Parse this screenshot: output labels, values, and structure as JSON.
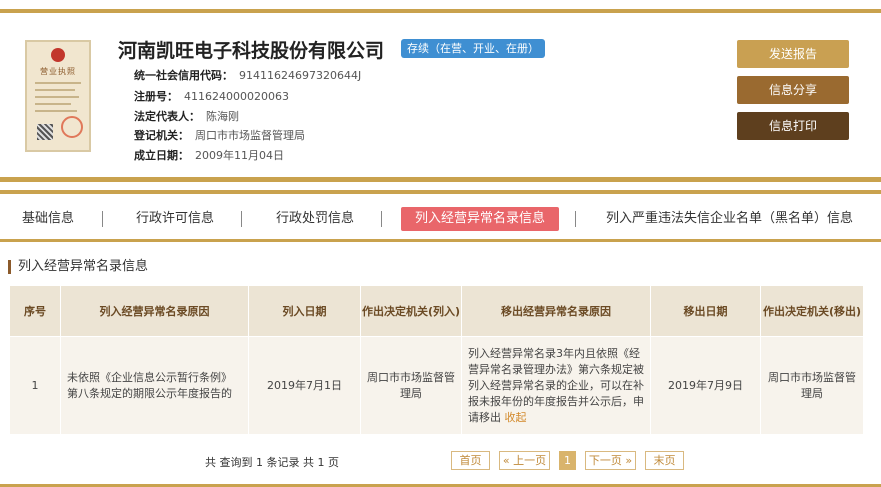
{
  "company": {
    "name": "河南凯旺电子科技股份有限公司",
    "status": "存续（在营、开业、在册）",
    "license_title": "营业执照"
  },
  "info": [
    {
      "label": "统一社会信用代码：",
      "value": "91411624697320644J"
    },
    {
      "label": "注册号：",
      "value": "411624000020063"
    },
    {
      "label": "法定代表人：",
      "value": "陈海刚"
    },
    {
      "label": "登记机关：",
      "value": "周口市市场监督管理局"
    },
    {
      "label": "成立日期：",
      "value": "2009年11月04日"
    }
  ],
  "actions": {
    "send": "发送报告",
    "share": "信息分享",
    "print": "信息打印"
  },
  "tabs": [
    {
      "label": "基础信息"
    },
    {
      "label": "行政许可信息"
    },
    {
      "label": "行政处罚信息"
    },
    {
      "label": "列入经营异常名录信息"
    },
    {
      "label": "列入严重违法失信企业名单（黑名单）信息"
    }
  ],
  "section": {
    "title": "列入经营异常名录信息"
  },
  "table": {
    "headers": [
      "序号",
      "列入经营异常名录原因",
      "列入日期",
      "作出决定机关(列入)",
      "移出经营异常名录原因",
      "移出日期",
      "作出决定机关(移出)"
    ],
    "rows": [
      {
        "index": "1",
        "reason": "未依照《企业信息公示暂行条例》第八条规定的期限公示年度报告的",
        "date_in": "2019年7月1日",
        "authority_in": "周口市市场监督管理局",
        "remove_reason": "列入经营异常名录3年内且依照《经营异常名录管理办法》第六条规定被列入经营异常名录的企业，可以在补报未报年份的年度报告并公示后，申请移出",
        "collapse": "收起",
        "date_out": "2019年7月9日",
        "authority_out": "周口市市场监督管理局"
      }
    ]
  },
  "pager": {
    "summary": "共 查询到 1 条记录 共 1 页",
    "first": "首页",
    "prev": "« 上一页",
    "current": "1",
    "next": "下一页 »",
    "last": "末页"
  },
  "colors": {
    "accent_gold": "#c9a24e",
    "active_tab": "#e9666a",
    "status_badge": "#3f8fd2"
  }
}
